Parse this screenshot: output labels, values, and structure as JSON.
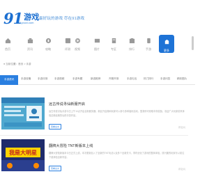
{
  "header": {
    "logo_number": "91",
    "logo_text": "游戏",
    "logo_subtext": "91youxi.com",
    "slogan": "最好玩的游戏 尽在91游戏"
  },
  "nav": [
    {
      "label": "首页",
      "icon": "home-icon"
    },
    {
      "label": "资讯",
      "icon": "news-icon"
    },
    {
      "label": "攻略",
      "icon": "guide-icon"
    },
    {
      "label": "评测",
      "icon": "review-icon"
    },
    {
      "label": "视频",
      "icon": "video-icon"
    },
    {
      "label": "图片",
      "icon": "image-icon"
    },
    {
      "label": "专区",
      "icon": "zone-icon"
    },
    {
      "label": "排行",
      "icon": "rank-icon"
    },
    {
      "label": "手游",
      "icon": "mobile-icon",
      "active": true
    },
    {
      "label": "更多",
      "icon": "more-icon"
    }
  ],
  "breadcrumb": "● 当前位置：首页 > 手游",
  "tabs": [
    "手游资讯",
    "手游攻略",
    "手游评测",
    "手游视频",
    "手游专题",
    "新游推荐",
    "开服开测",
    "手游礼包",
    "热门排行",
    "手游问答",
    "精彩图片",
    "新闻动态"
  ],
  "articles": [
    {
      "title": "远古传说寻仙新服开启",
      "desc": "远古传说寻仙手游今日上午10点开启全新服务器，新区开启期间玩家可以参与多种福利活动，登录即可领取丰厚奖励，欢迎广大玩家前来体验这款经典的仙侠手游作品。",
      "date": "2016-01-22",
      "button": "查看全文",
      "comments": "评论(0)"
    },
    {
      "title": "翻牌大冒险 TNT新版本上线",
      "desc": "翻牌大冒险新版本今日正式上线，本次更新加入了全新的TNT玩法以及多个全新关卡，同时优化了游戏的整体体验，感兴趣的玩家可以前往下载体验全新内容。",
      "date": "2016-01-22",
      "button": "查看全文",
      "comments": "评论(0)"
    }
  ],
  "thumb2_text": "我是大明星",
  "colors": {
    "brand": "#1b6fd1",
    "active": "#2a7fe0"
  }
}
